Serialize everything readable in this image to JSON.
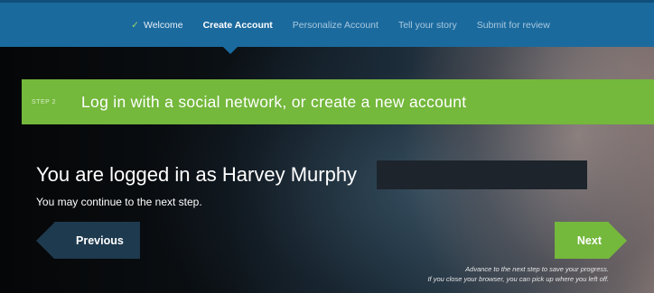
{
  "nav": {
    "items": [
      {
        "label": "Welcome",
        "state": "done",
        "icon": "check-icon"
      },
      {
        "label": "Create Account",
        "state": "active"
      },
      {
        "label": "Personalize Account",
        "state": "upcoming"
      },
      {
        "label": "Tell your story",
        "state": "upcoming"
      },
      {
        "label": "Submit for review",
        "state": "upcoming"
      }
    ],
    "check_glyph": "✓"
  },
  "step": {
    "tag": "STEP 2",
    "title": "Log in with a social network, or create a new account"
  },
  "status": {
    "logged_in_text": "You are logged in as Harvey Murphy",
    "continue_text": "You may continue to the next step."
  },
  "buttons": {
    "previous_label": "Previous",
    "next_label": "Next"
  },
  "hint": {
    "line1": "Advance to the next step to save your progress.",
    "line2": "If you close your browser, you can pick up where you left off."
  },
  "colors": {
    "nav_blue": "#1b6a9e",
    "accent_green": "#74b83c",
    "dark_button": "#1e3a4e"
  }
}
